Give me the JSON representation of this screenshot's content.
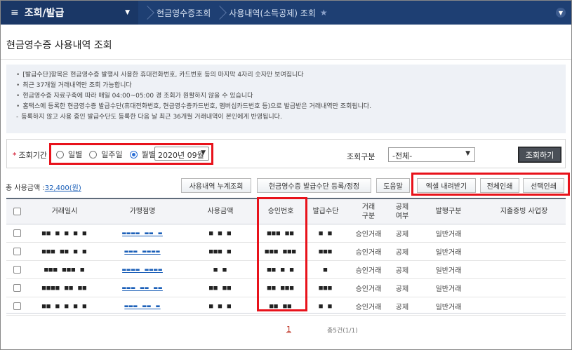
{
  "nav": {
    "menu_title": "조회/발급",
    "crumbs": [
      "현금영수증조회",
      "사용내역(소득공제) 조회"
    ]
  },
  "page": {
    "title": "현금영수증 사용내역 조회"
  },
  "notice": [
    "[발급수단]항목은 현금영수증 발행시 사용한 휴대전화번호, 카드번호 등의 마지막 4자리 숫자만 보여집니다",
    "최근 37개월 거래내역만 조회 가능합니다",
    "현금영수증 자료구축에 따라 매일 04:00~05:00 경 조회가 원활하지 않을 수 있습니다",
    "홈택스에 등록한 현금영수증 발급수단(휴대전화번호, 현금영수증카드번호, 멤버십카드번호 등)으로 발급받은 거래내역만 조회됩니다.",
    "등록하지 않고 사용 중인 발급수단도 등록한 다음 날 최근 36개월 거래내역이 본인에게 반영됩니다."
  ],
  "search": {
    "period_label": "조회기간",
    "options": [
      "일별",
      "일주일",
      "월별"
    ],
    "selected_option": "월별",
    "month_value": "2020년 09월",
    "kind_label": "조회구분",
    "kind_value": "-전체-",
    "submit_label": "조회하기"
  },
  "summary": {
    "label": "총 사용금액 :",
    "amount": "32,400(원)"
  },
  "buttons": {
    "cumulative": "사용내역 누계조회",
    "register": "현금영수증 발급수단 등록/정정",
    "help": "도움말",
    "excel": "엑셀 내려받기",
    "print_all": "전체인쇄",
    "print_selected": "선택인쇄"
  },
  "table": {
    "headers": [
      "거래일시",
      "가맹점명",
      "사용금액",
      "승인번호",
      "발급수단",
      "거래\n구분",
      "공제\n여부",
      "발행구분",
      "지출증빙 사업장"
    ],
    "rows": [
      {
        "date": "■■ ■ ■ ■ ■",
        "store": "▬▬▬▬ ▬▬ ▬",
        "amount": "■ ■ ■",
        "approval": "■■■ ■■",
        "means": "■ ■",
        "type": "승인거래",
        "deduct": "공제",
        "issue": "일반거래",
        "biz": ""
      },
      {
        "date": "■■■ ■■ ■ ■",
        "store": "▬▬▬ ▬▬▬▬",
        "amount": "■■■ ■",
        "approval": "■■■ ■■■",
        "means": "■■■",
        "type": "승인거래",
        "deduct": "공제",
        "issue": "일반거래",
        "biz": ""
      },
      {
        "date": "■■■ ■■■ ■",
        "store": "▬▬▬▬ ▬▬▬▬",
        "amount": "■ ■",
        "approval": "■■ ■ ■",
        "means": "■",
        "type": "승인거래",
        "deduct": "공제",
        "issue": "일반거래",
        "biz": ""
      },
      {
        "date": "■■■■ ■■ ■■",
        "store": "▬▬▬ ▬▬ ▬▬",
        "amount": "■■ ■■",
        "approval": "■■ ■■■",
        "means": "■■■",
        "type": "승인거래",
        "deduct": "공제",
        "issue": "일반거래",
        "biz": ""
      },
      {
        "date": "■■ ■ ■ ■ ■",
        "store": "▬▬▬ ▬▬ ▬",
        "amount": "■ ■ ■",
        "approval": "■■ ■■",
        "means": "■ ■",
        "type": "승인거래",
        "deduct": "공제",
        "issue": "일반거래",
        "biz": ""
      }
    ]
  },
  "pager": {
    "page": "1",
    "total": "총5건(1/1)"
  }
}
